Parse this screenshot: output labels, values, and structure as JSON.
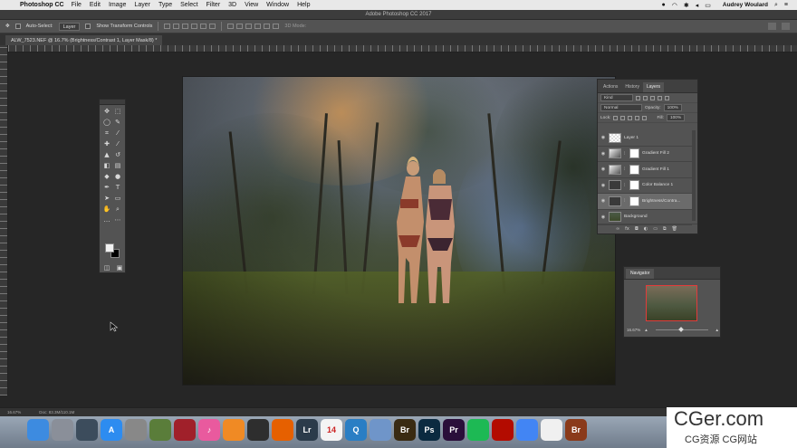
{
  "menubar": {
    "app_name": "Photoshop CC",
    "items": [
      "File",
      "Edit",
      "Image",
      "Layer",
      "Type",
      "Select",
      "Filter",
      "3D",
      "View",
      "Window",
      "Help"
    ],
    "user": "Audrey Woulard"
  },
  "window_title": "Adobe Photoshop CC 2017",
  "options": {
    "auto_select_label": "Auto-Select:",
    "auto_select_value": "Layer",
    "show_transform_label": "Show Transform Controls",
    "mode_3d_label": "3D Mode:"
  },
  "document_tab": "ALW_7523.NEF @ 16.7% (Brightness/Contrast 1, Layer Mask/8) *",
  "layers_panel": {
    "tabs": [
      "Actions",
      "History",
      "Layers"
    ],
    "active_tab": "Layers",
    "kind_label": "Kind",
    "blend_mode": "Normal",
    "opacity_label": "Opacity:",
    "opacity_value": "100%",
    "lock_label": "Lock:",
    "fill_label": "Fill:",
    "fill_value": "100%",
    "layers": [
      {
        "name": "Layer 1",
        "thumb": "checker",
        "mask": false,
        "selected": false
      },
      {
        "name": "Gradient Fill 2",
        "thumb": "grad",
        "mask": true,
        "selected": false
      },
      {
        "name": "Gradient Fill 1",
        "thumb": "grad",
        "mask": true,
        "selected": false
      },
      {
        "name": "Color Balance 1",
        "thumb": "adj",
        "mask": true,
        "selected": false
      },
      {
        "name": "Brightness/Contra...",
        "thumb": "adj",
        "mask": true,
        "selected": true
      },
      {
        "name": "Background",
        "thumb": "photo",
        "mask": false,
        "selected": false
      }
    ]
  },
  "navigator": {
    "tab": "Navigator",
    "zoom": "16.67%"
  },
  "status": {
    "zoom": "16.67%",
    "doc": "Doc: 83.3M/110.1M"
  },
  "dock": {
    "apps": [
      {
        "name": "Finder",
        "label": "",
        "color": "#3d8be0"
      },
      {
        "name": "Launchpad",
        "label": "",
        "color": "#8a8f99"
      },
      {
        "name": "Mission Control",
        "label": "",
        "color": "#3c4c5c"
      },
      {
        "name": "App Store",
        "label": "A",
        "color": "#2d8cf0"
      },
      {
        "name": "System Preferences",
        "label": "",
        "color": "#888"
      },
      {
        "name": "Calibre",
        "label": "",
        "color": "#5a7d3a"
      },
      {
        "name": "Photo Booth",
        "label": "",
        "color": "#a0202a"
      },
      {
        "name": "iTunes",
        "label": "♪",
        "color": "#e95a9e"
      },
      {
        "name": "iBooks",
        "label": "",
        "color": "#f08a24"
      },
      {
        "name": "Activity Monitor",
        "label": "",
        "color": "#2e2e2e"
      },
      {
        "name": "Firefox",
        "label": "",
        "color": "#e66000"
      },
      {
        "name": "Lightroom",
        "label": "Lr",
        "color": "#2b3b4a"
      },
      {
        "name": "Calendar",
        "label": "14",
        "color": "#f4f4f4"
      },
      {
        "name": "QuickTime",
        "label": "Q",
        "color": "#2a7ec4"
      },
      {
        "name": "Preview",
        "label": "",
        "color": "#6f95c9"
      },
      {
        "name": "Bridge",
        "label": "Br",
        "color": "#3a2b12"
      },
      {
        "name": "Photoshop",
        "label": "Ps",
        "color": "#0b2a40"
      },
      {
        "name": "Premiere",
        "label": "Pr",
        "color": "#2a0e3a"
      },
      {
        "name": "Spotify",
        "label": "",
        "color": "#1db954"
      },
      {
        "name": "Acrobat",
        "label": "",
        "color": "#b30b00"
      },
      {
        "name": "Chrome",
        "label": "",
        "color": "#4285f4"
      },
      {
        "name": "Home",
        "label": "",
        "color": "#f0f0f0"
      },
      {
        "name": "Bridge 2",
        "label": "Br",
        "color": "#8a3a1a"
      }
    ]
  },
  "watermark": {
    "big": "CGer.com",
    "small": "CG资源 CG网站"
  }
}
